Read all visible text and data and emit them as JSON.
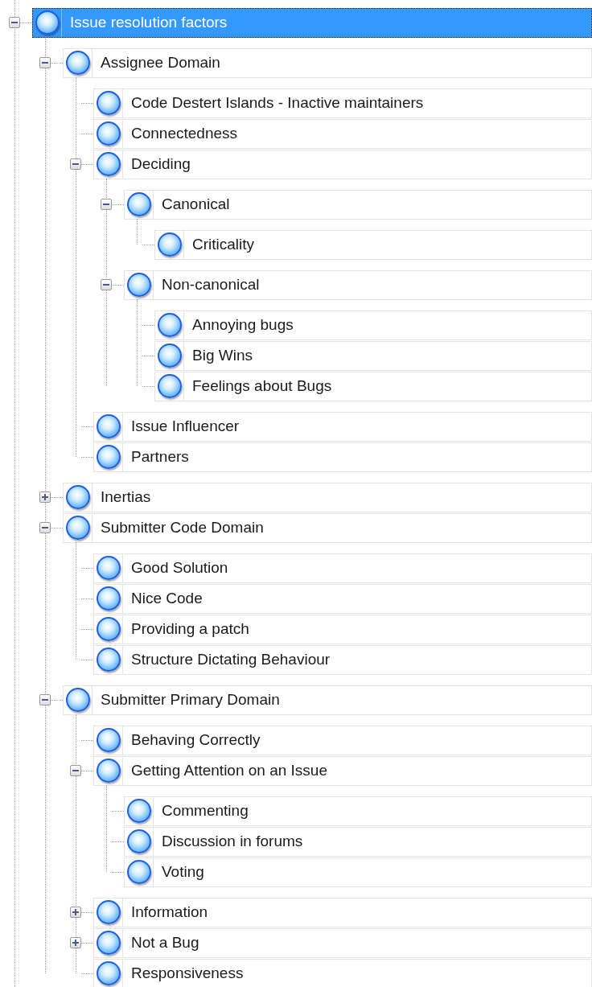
{
  "tree": [
    {
      "label": "Issue resolution factors",
      "selected": true,
      "expanded": true,
      "children": [
        {
          "label": "Assignee Domain",
          "selected": false,
          "expanded": true,
          "children": [
            {
              "label": "Code Destert Islands - Inactive maintainers",
              "selected": false
            },
            {
              "label": "Connectedness",
              "selected": false
            },
            {
              "label": "Deciding",
              "selected": false,
              "expanded": true,
              "children": [
                {
                  "label": "Canonical",
                  "selected": false,
                  "expanded": true,
                  "children": [
                    {
                      "label": "Criticality",
                      "selected": false
                    }
                  ]
                },
                {
                  "label": "Non-canonical",
                  "selected": false,
                  "expanded": true,
                  "children": [
                    {
                      "label": "Annoying bugs",
                      "selected": false
                    },
                    {
                      "label": "Big Wins",
                      "selected": false
                    },
                    {
                      "label": "Feelings about Bugs",
                      "selected": false
                    }
                  ]
                }
              ]
            },
            {
              "label": "Issue Influencer",
              "selected": false
            },
            {
              "label": "Partners",
              "selected": false
            }
          ]
        },
        {
          "label": "Inertias",
          "selected": false,
          "expanded": false
        },
        {
          "label": "Submitter Code Domain",
          "selected": false,
          "expanded": true,
          "children": [
            {
              "label": "Good Solution",
              "selected": false
            },
            {
              "label": "Nice Code",
              "selected": false
            },
            {
              "label": "Providing a patch",
              "selected": false
            },
            {
              "label": "Structure Dictating Behaviour",
              "selected": false
            }
          ]
        },
        {
          "label": "Submitter Primary Domain",
          "selected": false,
          "expanded": true,
          "children": [
            {
              "label": "Behaving Correctly",
              "selected": false
            },
            {
              "label": "Getting Attention on an Issue",
              "selected": false,
              "expanded": true,
              "children": [
                {
                  "label": "Commenting",
                  "selected": false
                },
                {
                  "label": "Discussion in forums",
                  "selected": false
                },
                {
                  "label": "Voting",
                  "selected": false
                }
              ]
            },
            {
              "label": "Information",
              "selected": false,
              "expanded": false
            },
            {
              "label": "Not a Bug",
              "selected": false,
              "expanded": false
            },
            {
              "label": "Responsiveness",
              "selected": false
            }
          ]
        }
      ]
    }
  ]
}
